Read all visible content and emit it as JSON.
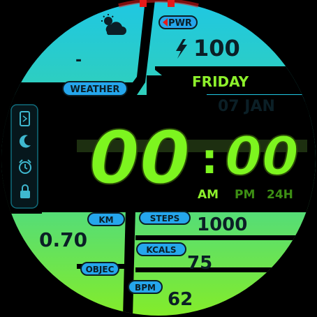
{
  "weather": {
    "label": "WEATHER",
    "icon": "partly-cloudy-icon",
    "temperature": "-"
  },
  "battery": {
    "label": "PWR",
    "icon": "lightning-bolt-icon",
    "value": "100"
  },
  "date": {
    "day_of_week": "FRIDAY",
    "date_text": "07 JAN"
  },
  "time": {
    "hours": "00",
    "separator": ":",
    "minutes": "00",
    "am": "AM",
    "pm": "PM",
    "format_24h": "24H"
  },
  "side_icons": [
    "phone-vibrate-icon",
    "moon-icon",
    "alarm-icon",
    "lock-icon"
  ],
  "distance": {
    "label": "KM",
    "value": "0.70"
  },
  "steps": {
    "label": "STEPS",
    "value": "1000"
  },
  "calories": {
    "label": "KCALS",
    "value": "75"
  },
  "heart_rate": {
    "label": "BPM",
    "value": "62"
  },
  "goal": {
    "label": "OBJEC"
  },
  "colors": {
    "gradient_top": "#1fc7e3",
    "gradient_bottom": "#84ec29",
    "lcd_green": "#7df51f",
    "lcd_outline": "#2a4a08",
    "dark_text": "#0b1f26",
    "pill_blue": "#25a6ec",
    "ring_red": "#e51a1a",
    "am_active": "#8df02b",
    "pm_inactive": "#3d8f14"
  }
}
